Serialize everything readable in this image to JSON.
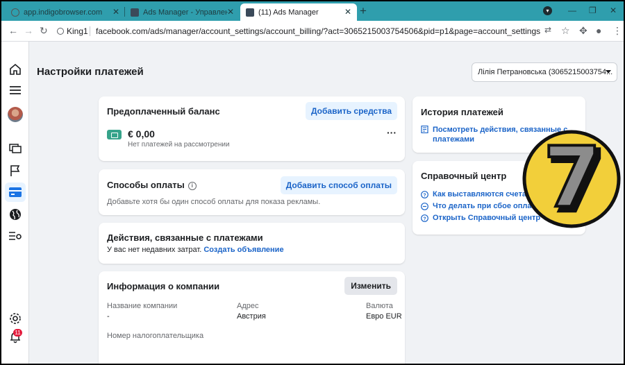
{
  "browser": {
    "tabs": [
      {
        "title": "app.indigobrowser.com"
      },
      {
        "title": "Ads Manager - Управление рекл"
      },
      {
        "title": "(11) Ads Manager"
      }
    ],
    "profile": "King1",
    "url": "facebook.com/ads/manager/account_settings/account_billing/?act=3065215003754506&pid=p1&page=account_settings&tab=account_billing_s..."
  },
  "sidebar": {
    "notification_count": "11"
  },
  "page": {
    "title": "Настройки платежей",
    "account": "Лілія Петрановська (3065215003754..."
  },
  "prepaid": {
    "title": "Предоплаченный баланс",
    "add_funds": "Добавить средства",
    "amount": "€ 0,00",
    "pending": "Нет платежей на рассмотрении",
    "more": "···"
  },
  "payment_methods": {
    "title": "Способы оплаты",
    "add_method": "Добавить способ оплаты",
    "hint": "Добавьте хотя бы один способ оплаты для показа рекламы."
  },
  "activity": {
    "title": "Действия, связанные с платежами",
    "text": "У вас нет недавних затрат.",
    "create_ad": "Создать объявление"
  },
  "company": {
    "title": "Информация о компании",
    "edit": "Изменить",
    "name_label": "Название компании",
    "name_value": "-",
    "address_label": "Адрес",
    "address_value": "Австрия",
    "currency_label": "Валюта",
    "currency_value": "Евро EUR",
    "tax_label": "Номер налогоплательщика"
  },
  "history": {
    "title": "История платежей",
    "link_line1": "Посмотреть действия, связанные с",
    "link_line2": "платежами"
  },
  "help": {
    "title": "Справочный центр",
    "links": [
      "Как выставляются счета",
      "Что делать при сбое оплат",
      "Открыть Справочный центр"
    ]
  },
  "overlay": {
    "logo_glyph": "7"
  },
  "colors": {
    "tabbar": "#2f9ead",
    "link": "#1b64c8",
    "button_bg": "#e7f3ff",
    "logo_yellow": "#f2cf3a"
  }
}
